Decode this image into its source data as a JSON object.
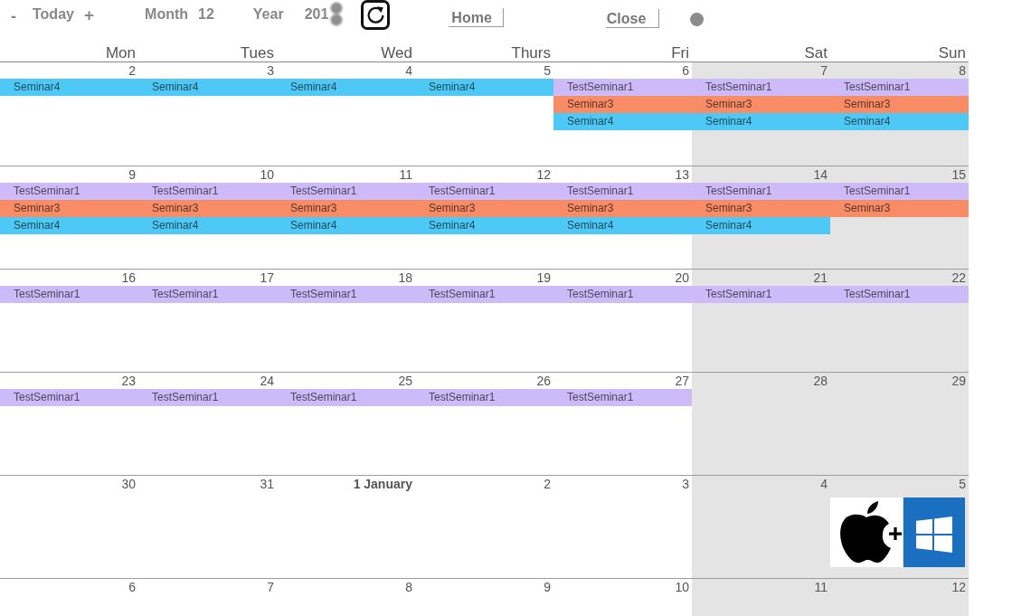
{
  "toolbar": {
    "previous_button": "-",
    "today_button": "Today",
    "next_button": "+",
    "month": {
      "label": "Month",
      "value": "12"
    },
    "year": {
      "label": "Year",
      "value": "201"
    },
    "home_button": "Home",
    "close_button": "Close"
  },
  "columns": [
    {
      "label": "Mon",
      "weekend": false
    },
    {
      "label": "Tues",
      "weekend": false
    },
    {
      "label": "Wed",
      "weekend": false
    },
    {
      "label": "Thurs",
      "weekend": false
    },
    {
      "label": "Fri",
      "weekend": false
    },
    {
      "label": "Sat",
      "weekend": true
    },
    {
      "label": "Sun",
      "weekend": true
    }
  ],
  "weeks": [
    {
      "days": [
        {
          "label": "2",
          "kind": "date",
          "events": [
            {
              "label": "Seminar4",
              "color": "#4ec8f4"
            }
          ]
        },
        {
          "label": "3",
          "kind": "date",
          "events": [
            {
              "label": "Seminar4",
              "color": "#4ec8f4"
            }
          ]
        },
        {
          "label": "4",
          "kind": "date",
          "events": [
            {
              "label": "Seminar4",
              "color": "#4ec8f4"
            }
          ]
        },
        {
          "label": "5",
          "kind": "date",
          "events": [
            {
              "label": "Seminar4",
              "color": "#4ec8f4"
            }
          ]
        },
        {
          "label": "6",
          "kind": "date",
          "events": [
            {
              "label": "TestSeminar1",
              "color": "#cdbaf8"
            },
            {
              "label": "Seminar3",
              "color": "#f78c66"
            },
            {
              "label": "Seminar4",
              "color": "#4ec8f4"
            }
          ]
        },
        {
          "label": "7",
          "kind": "date",
          "events": [
            {
              "label": "TestSeminar1",
              "color": "#cdbaf8"
            },
            {
              "label": "Seminar3",
              "color": "#f78c66"
            },
            {
              "label": "Seminar4",
              "color": "#4ec8f4"
            }
          ]
        },
        {
          "label": "8",
          "kind": "date",
          "events": [
            {
              "label": "TestSeminar1",
              "color": "#cdbaf8"
            },
            {
              "label": "Seminar3",
              "color": "#f78c66"
            },
            {
              "label": "Seminar4",
              "color": "#4ec8f4"
            }
          ]
        }
      ]
    },
    {
      "days": [
        {
          "label": "9",
          "kind": "date",
          "events": [
            {
              "label": "TestSeminar1",
              "color": "#cdbaf8"
            },
            {
              "label": "Seminar3",
              "color": "#f78c66"
            },
            {
              "label": "Seminar4",
              "color": "#4ec8f4"
            }
          ]
        },
        {
          "label": "10",
          "kind": "date",
          "events": [
            {
              "label": "TestSeminar1",
              "color": "#cdbaf8"
            },
            {
              "label": "Seminar3",
              "color": "#f78c66"
            },
            {
              "label": "Seminar4",
              "color": "#4ec8f4"
            }
          ]
        },
        {
          "label": "11",
          "kind": "date",
          "events": [
            {
              "label": "TestSeminar1",
              "color": "#cdbaf8"
            },
            {
              "label": "Seminar3",
              "color": "#f78c66"
            },
            {
              "label": "Seminar4",
              "color": "#4ec8f4"
            }
          ]
        },
        {
          "label": "12",
          "kind": "date",
          "events": [
            {
              "label": "TestSeminar1",
              "color": "#cdbaf8"
            },
            {
              "label": "Seminar3",
              "color": "#f78c66"
            },
            {
              "label": "Seminar4",
              "color": "#4ec8f4"
            }
          ]
        },
        {
          "label": "13",
          "kind": "date",
          "events": [
            {
              "label": "TestSeminar1",
              "color": "#cdbaf8"
            },
            {
              "label": "Seminar3",
              "color": "#f78c66"
            },
            {
              "label": "Seminar4",
              "color": "#4ec8f4"
            }
          ]
        },
        {
          "label": "14",
          "kind": "date",
          "events": [
            {
              "label": "TestSeminar1",
              "color": "#cdbaf8"
            },
            {
              "label": "Seminar3",
              "color": "#f78c66"
            },
            {
              "label": "Seminar4",
              "color": "#4ec8f4"
            }
          ]
        },
        {
          "label": "15",
          "kind": "date",
          "events": [
            {
              "label": "TestSeminar1",
              "color": "#cdbaf8"
            },
            {
              "label": "Seminar3",
              "color": "#f78c66"
            }
          ]
        }
      ]
    },
    {
      "days": [
        {
          "label": "16",
          "kind": "date",
          "events": [
            {
              "label": "TestSeminar1",
              "color": "#cdbaf8"
            }
          ]
        },
        {
          "label": "17",
          "kind": "date",
          "events": [
            {
              "label": "TestSeminar1",
              "color": "#cdbaf8"
            }
          ]
        },
        {
          "label": "18",
          "kind": "date",
          "events": [
            {
              "label": "TestSeminar1",
              "color": "#cdbaf8"
            }
          ]
        },
        {
          "label": "19",
          "kind": "date",
          "events": [
            {
              "label": "TestSeminar1",
              "color": "#cdbaf8"
            }
          ]
        },
        {
          "label": "20",
          "kind": "date",
          "events": [
            {
              "label": "TestSeminar1",
              "color": "#cdbaf8"
            }
          ]
        },
        {
          "label": "21",
          "kind": "date",
          "events": [
            {
              "label": "TestSeminar1",
              "color": "#cdbaf8"
            }
          ]
        },
        {
          "label": "22",
          "kind": "date",
          "events": [
            {
              "label": "TestSeminar1",
              "color": "#cdbaf8"
            }
          ]
        }
      ]
    },
    {
      "days": [
        {
          "label": "23",
          "kind": "date",
          "events": [
            {
              "label": "TestSeminar1",
              "color": "#cdbaf8"
            }
          ]
        },
        {
          "label": "24",
          "kind": "date",
          "events": [
            {
              "label": "TestSeminar1",
              "color": "#cdbaf8"
            }
          ]
        },
        {
          "label": "25",
          "kind": "date",
          "events": [
            {
              "label": "TestSeminar1",
              "color": "#cdbaf8"
            }
          ]
        },
        {
          "label": "26",
          "kind": "date",
          "events": [
            {
              "label": "TestSeminar1",
              "color": "#cdbaf8"
            }
          ]
        },
        {
          "label": "27",
          "kind": "date",
          "events": [
            {
              "label": "TestSeminar1",
              "color": "#cdbaf8"
            }
          ]
        },
        {
          "label": "28",
          "kind": "date"
        },
        {
          "label": "29",
          "kind": "date"
        }
      ]
    },
    {
      "days": [
        {
          "label": "30",
          "kind": "date"
        },
        {
          "label": "31",
          "kind": "date"
        },
        {
          "label": "1 January",
          "kind": "month_start"
        },
        {
          "label": "2",
          "kind": "date"
        },
        {
          "label": "3",
          "kind": "date"
        },
        {
          "label": "4",
          "kind": "date"
        },
        {
          "label": "5",
          "kind": "date_with_logo"
        }
      ]
    },
    {
      "days": [
        {
          "label": "6",
          "kind": "date"
        },
        {
          "label": "7",
          "kind": "date"
        },
        {
          "label": "8",
          "kind": "date"
        },
        {
          "label": "9",
          "kind": "date"
        },
        {
          "label": "10",
          "kind": "date"
        },
        {
          "label": "11",
          "kind": "date"
        },
        {
          "label": "12",
          "kind": "date"
        }
      ]
    }
  ]
}
